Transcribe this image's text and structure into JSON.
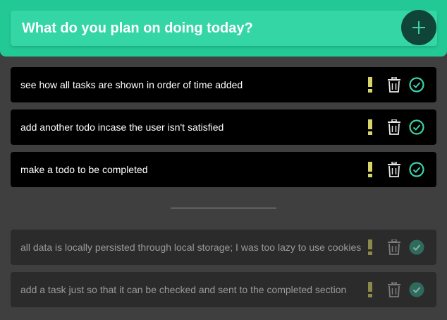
{
  "header": {
    "placeholder": "What do you plan on doing today?",
    "add_icon": "plus-icon"
  },
  "active_todos": [
    {
      "text": "see how all tasks are shown in order of time added"
    },
    {
      "text": "add another todo incase the user isn't satisfied"
    },
    {
      "text": "make a todo to be completed"
    }
  ],
  "completed_todos": [
    {
      "text": "all data is locally persisted through local storage; I was too lazy to use cookies"
    },
    {
      "text": "add a task just so that it can be checked and sent to the completed section"
    }
  ],
  "icons": {
    "important": "exclamation-icon",
    "delete": "trash-icon",
    "complete": "check-circle-icon"
  },
  "colors": {
    "header": "#23c994",
    "input": "#35d6a6",
    "add_button": "#114438",
    "important_active": "#d7d46a",
    "important_done": "#8a8a4a",
    "check_active": "#3fd1a8",
    "check_done": "#2f6b5c"
  }
}
